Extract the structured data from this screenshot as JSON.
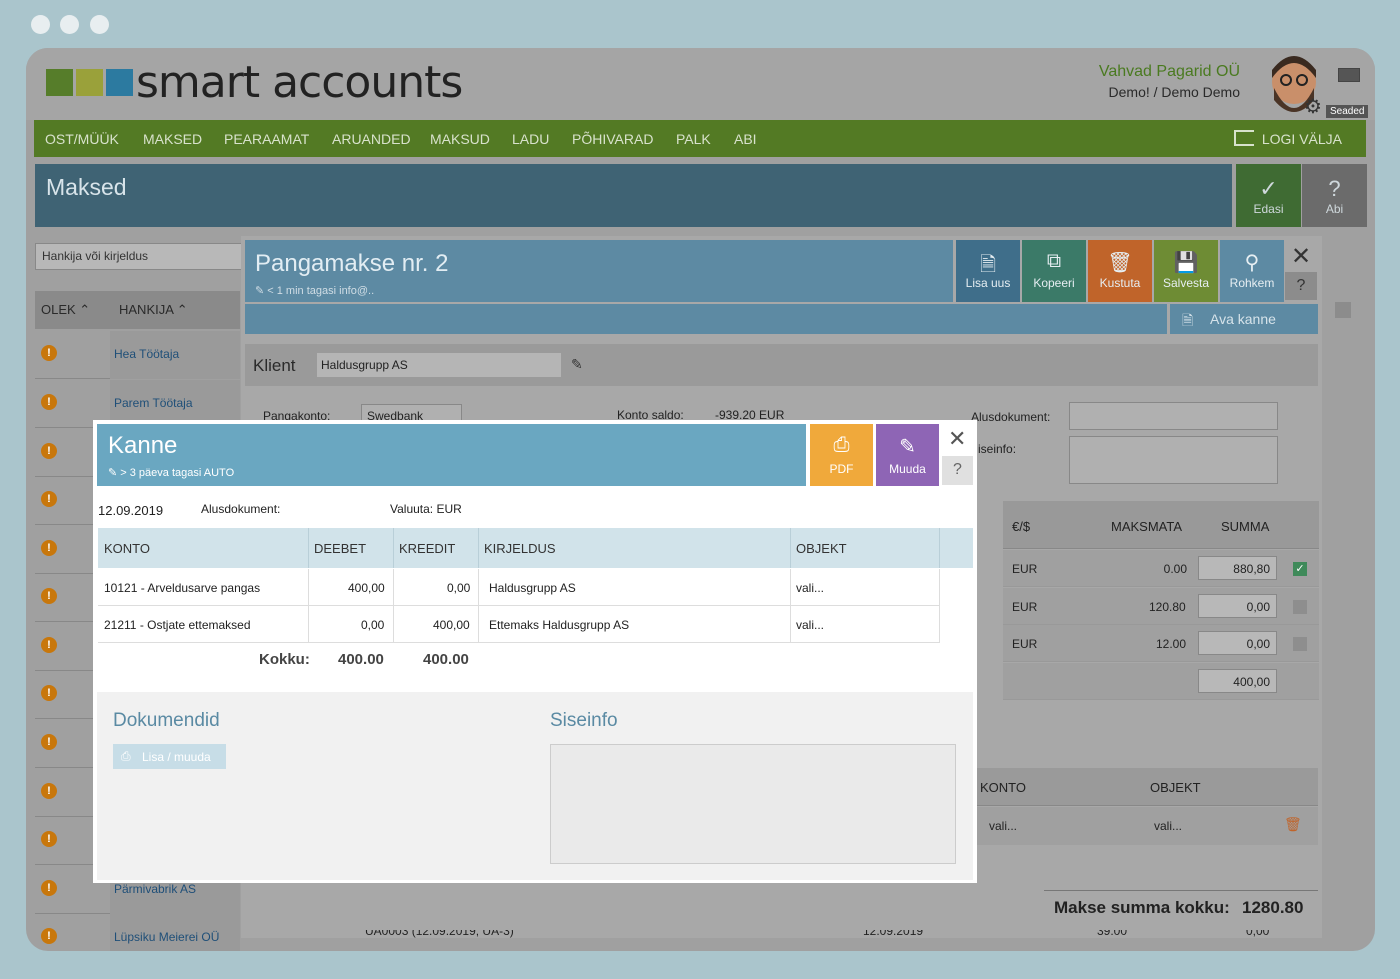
{
  "header": {
    "brand": "smart accounts",
    "company": "Vahvad Pagarid OÜ",
    "user": "Demo! / Demo Demo",
    "settings_label": "Seaded",
    "logo_colors": [
      "#567d2a",
      "#9aa13a",
      "#2c7aa0"
    ]
  },
  "nav": {
    "items": [
      "OST/MÜÜK",
      "MAKSED",
      "PEARAAMAT",
      "ARUANDED",
      "MAKSUD",
      "LADU",
      "PÕHIVARAD",
      "PALK",
      "ABI"
    ],
    "logout": "LOGI VÄLJA"
  },
  "page": {
    "title": "Maksed",
    "edasi": "Edasi",
    "abi": "Abi",
    "search_placeholder": "Hankija või kirjeldus",
    "col_olek": "OLEK ⌃",
    "col_hankija": "HANKIJA ⌃",
    "rows": [
      "Hea Töötaja",
      "Parem Töötaja",
      "",
      "",
      "",
      "",
      "",
      "",
      "",
      "",
      "",
      "Pärmivabrik AS",
      "Lüpsiku Meierei OÜ"
    ]
  },
  "payment": {
    "title": "Pangamakse nr. 2",
    "subtitle": "< 1 min tagasi info@..",
    "buttons": [
      "Lisa uus",
      "Kopeeri",
      "Kustuta",
      "Salvesta",
      "Rohkem"
    ],
    "button_colors": [
      "#3f6e8a",
      "#3b7a68",
      "#c0642a",
      "#6e8c34",
      "#5d8aa3"
    ],
    "ava_kanne": "Ava kanne",
    "klient_label": "Klient",
    "klient_value": "Haldusgrupp AS",
    "pangakonto_label": "Pangakonto:",
    "pangakonto_value": "Swedbank",
    "konto_saldo_label": "Konto saldo:",
    "konto_saldo_value": "-939.20 EUR",
    "alusdokument_label": "Alusdokument:",
    "siseinfo_label": "iseinfo:",
    "col_currency": "€/$",
    "col_maksmata": "MAKSMATA",
    "col_summa": "SUMMA",
    "rows": [
      {
        "cur": "EUR",
        "maksmata": "0.00",
        "summa": "880,80",
        "checked": true
      },
      {
        "cur": "EUR",
        "maksmata": "120.80",
        "summa": "0,00",
        "checked": false
      },
      {
        "cur": "EUR",
        "maksmata": "12.00",
        "summa": "0,00",
        "checked": false
      }
    ],
    "subtotal": "400,00",
    "konto_col": "KONTO",
    "objekt_col": "OBJEKT",
    "vali1": "vali...",
    "vali2": "vali...",
    "makse_kokku_label": "Makse summa kokku:",
    "makse_kokku_value": "1280.80",
    "bottom_row": {
      "a": "UA0003 (12.09.2019, UA-3)",
      "b": "12.09.2019",
      "c": "39.00",
      "d": "0,00"
    }
  },
  "kanne": {
    "title": "Kanne",
    "subtitle": "> 3 päeva tagasi AUTO",
    "pdf": "PDF",
    "muuda": "Muuda",
    "date": "12.09.2019",
    "alusdokument": "Alusdokument:",
    "valuuta": "Valuuta: EUR",
    "columns": [
      "KONTO",
      "DEEBET",
      "KREEDIT",
      "KIRJELDUS",
      "OBJEKT"
    ],
    "rows": [
      {
        "konto": "10121 - Arveldusarve pangas",
        "deebet": "400,00",
        "kreedit": "0,00",
        "kirjeldus": "Haldusgrupp AS",
        "objekt": "vali..."
      },
      {
        "konto": "21211 - Ostjate ettemaksed",
        "deebet": "0,00",
        "kreedit": "400,00",
        "kirjeldus": "Ettemaks Haldusgrupp AS",
        "objekt": "vali..."
      }
    ],
    "kokku_label": "Kokku:",
    "kokku_deebet": "400.00",
    "kokku_kreedit": "400.00",
    "dokumendid": "Dokumendid",
    "lisa_muuda": "Lisa / muuda",
    "siseinfo": "Siseinfo"
  }
}
